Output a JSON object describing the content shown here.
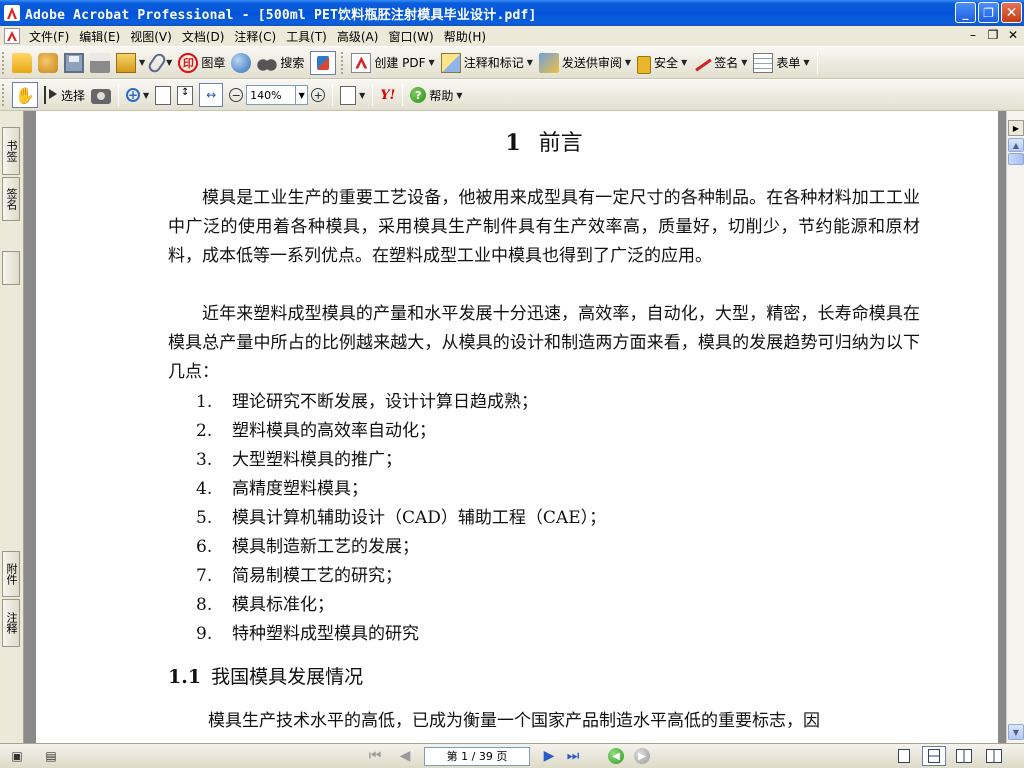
{
  "window": {
    "title": "Adobe Acrobat Professional - [500ml PET饮料瓶胚注射模具毕业设计.pdf]"
  },
  "menubar": {
    "items": [
      "文件(F)",
      "编辑(E)",
      "视图(V)",
      "文档(D)",
      "注释(C)",
      "工具(T)",
      "高级(A)",
      "窗口(W)",
      "帮助(H)"
    ]
  },
  "toolbar1": {
    "stamp_label": "图章",
    "search_label": "搜索",
    "create_pdf_label": "创建 PDF",
    "comment_label": "注释和标记",
    "review_label": "发送供审阅",
    "security_label": "安全",
    "sign_label": "签名",
    "forms_label": "表单"
  },
  "toolbar2": {
    "select_label": "选择",
    "zoom_value": "140%",
    "help_label": "帮助",
    "yahoo_label": "Y!"
  },
  "left_panel": {
    "tabs": [
      "书签",
      "签名",
      "",
      "附件",
      "注释"
    ]
  },
  "document": {
    "chapter_number": "1",
    "chapter_title": "前言",
    "paragraph1": "模具是工业生产的重要工艺设备，他被用来成型具有一定尺寸的各种制品。在各种材料加工工业中广泛的使用着各种模具，采用模具生产制件具有生产效率高，质量好，切削少，节约能源和原材料，成本低等一系列优点。在塑料成型工业中模具也得到了广泛的应用。",
    "paragraph2": "近年来塑料成型模具的产量和水平发展十分迅速，高效率，自动化，大型，精密，长寿命模具在模具总产量中所占的比例越来越大，从模具的设计和制造两方面来看，模具的发展趋势可归纳为以下几点：",
    "list": [
      {
        "n": "1.",
        "text": "理论研究不断发展，设计计算日趋成熟；"
      },
      {
        "n": "2.",
        "text": "塑料模具的高效率自动化；"
      },
      {
        "n": "3.",
        "text": "大型塑料模具的推广；"
      },
      {
        "n": "4.",
        "text": "高精度塑料模具；"
      },
      {
        "n": "5.",
        "text": "模具计算机辅助设计（CAD）辅助工程（CAE）；"
      },
      {
        "n": "6.",
        "text": "模具制造新工艺的发展；"
      },
      {
        "n": "7.",
        "text": "简易制模工艺的研究；"
      },
      {
        "n": "8.",
        "text": "模具标准化；"
      },
      {
        "n": "9.",
        "text": "特种塑料成型模具的研究"
      }
    ],
    "section_number": "1.1",
    "section_title": "我国模具发展情况",
    "paragraph3": "模具生产技术水平的高低，已成为衡量一个国家产品制造水平高低的重要标志，因"
  },
  "statusbar": {
    "page_indicator": "第 1 / 39 页"
  }
}
